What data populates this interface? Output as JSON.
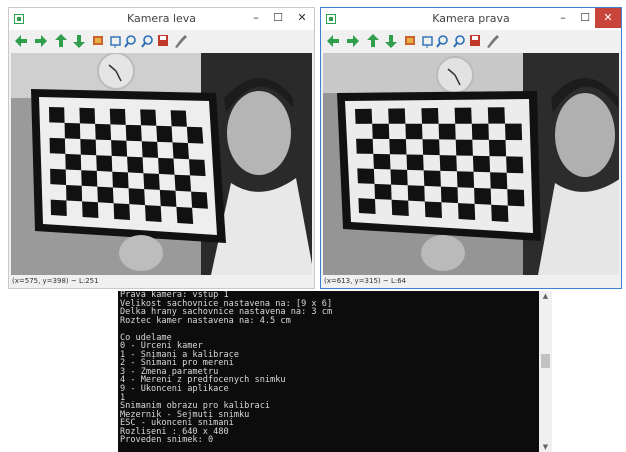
{
  "left_window": {
    "title": "Kamera leva",
    "status": "(x=575, y=398) ~ L:251",
    "controls": {
      "minimize": "–",
      "maximize": "☐",
      "close": "✕"
    }
  },
  "right_window": {
    "title": "Kamera prava",
    "status": "(x=613, y=315) ~ L:64",
    "controls": {
      "minimize": "–",
      "maximize": "☐",
      "close": "✕"
    }
  },
  "toolbar_icons": [
    "arrow-left-icon",
    "arrow-right-icon",
    "arrow-up-icon",
    "arrow-down-icon",
    "image-icon",
    "zoom-fit-icon",
    "zoom-in-icon",
    "zoom-out-icon",
    "save-icon",
    "properties-icon"
  ],
  "colors": {
    "active_border": "#3f7fd1",
    "arrow": "#2f9e4d",
    "close_active": "#c7453a",
    "console_bg": "#0c0c0c",
    "console_text": "#d9d9d9"
  },
  "console": {
    "lines": [
      "Prava kamera: vstup 1",
      "Velikost sachovnice nastavena na: [9 x 6]",
      "Delka hrany sachovnice nastavena na: 3 cm",
      "Roztec kamer nastavena na: 4.5 cm",
      "",
      "Co udelame",
      "0 - Urceni kamer",
      "1 - Snimani a kalibrace",
      "2 - Snimani pro mereni",
      "3 - Zmena parametru",
      "4 - Mereni z predfocenych snimku",
      "9 - Ukonceni aplikace",
      "1",
      "Snimanim obrazu pro kalibraci",
      "Mezernik - Sejmuti snimku",
      "ESC - ukonceni snimani",
      "Rozliseni : 640 x 480",
      "Proveden snimek: 0"
    ],
    "scroll_up": "▲",
    "scroll_down": "▼"
  }
}
